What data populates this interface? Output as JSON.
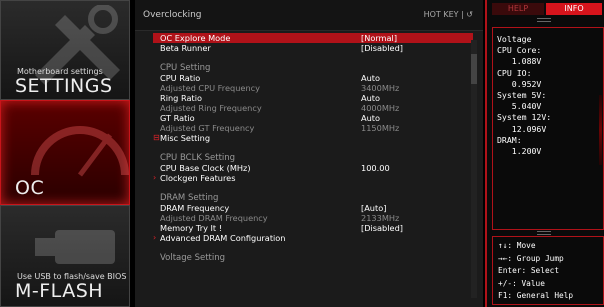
{
  "sidebar": {
    "settings": {
      "subtitle": "Motherboard settings",
      "title": "SETTINGS"
    },
    "oc": {
      "title": "OC"
    },
    "mflash": {
      "subtitle": "Use USB to flash/save BIOS",
      "title": "M-FLASH"
    }
  },
  "header": {
    "title": "Overclocking",
    "hotkey": "HOT KEY  |  ↺"
  },
  "rows": [
    {
      "label": "OC Explore Mode",
      "value": "[Normal]",
      "kind": "item",
      "highlight": true
    },
    {
      "label": "Beta Runner",
      "value": "[Disabled]",
      "kind": "item"
    },
    {
      "label": "",
      "value": "",
      "kind": "gap"
    },
    {
      "label": "CPU  Setting",
      "value": "",
      "kind": "section"
    },
    {
      "label": "CPU Ratio",
      "value": "Auto",
      "kind": "item"
    },
    {
      "label": "Adjusted CPU Frequency",
      "value": "3400MHz",
      "kind": "dim"
    },
    {
      "label": "Ring Ratio",
      "value": "Auto",
      "kind": "item"
    },
    {
      "label": "Adjusted Ring Frequency",
      "value": "4000MHz",
      "kind": "dim"
    },
    {
      "label": "GT Ratio",
      "value": "Auto",
      "kind": "item"
    },
    {
      "label": "Adjusted GT Frequency",
      "value": "1150MHz",
      "kind": "dim"
    },
    {
      "label": "Misc Setting",
      "value": "",
      "kind": "expand",
      "marker": "⊟"
    },
    {
      "label": "",
      "value": "",
      "kind": "gap"
    },
    {
      "label": "CPU  BCLK  Setting",
      "value": "",
      "kind": "section"
    },
    {
      "label": "CPU Base Clock (MHz)",
      "value": "100.00",
      "kind": "item"
    },
    {
      "label": "Clockgen Features",
      "value": "",
      "kind": "expand",
      "marker": "›"
    },
    {
      "label": "",
      "value": "",
      "kind": "gap"
    },
    {
      "label": "DRAM  Setting",
      "value": "",
      "kind": "section"
    },
    {
      "label": "DRAM Frequency",
      "value": "[Auto]",
      "kind": "item"
    },
    {
      "label": "Adjusted DRAM Frequency",
      "value": "2133MHz",
      "kind": "dim"
    },
    {
      "label": "Memory Try It !",
      "value": "[Disabled]",
      "kind": "item"
    },
    {
      "label": "Advanced DRAM Configuration",
      "value": "",
      "kind": "expand",
      "marker": "›"
    },
    {
      "label": "",
      "value": "",
      "kind": "gap"
    },
    {
      "label": "Voltage  Setting",
      "value": "",
      "kind": "section"
    }
  ],
  "panel": {
    "tabs": {
      "help": "HELP",
      "info": "INFO"
    },
    "info_lines": [
      "Voltage",
      "CPU Core:",
      "   1.088V",
      "CPU IO:",
      "   0.952V",
      "System 5V:",
      "   5.040V",
      "System 12V:",
      "   12.096V",
      "DRAM:",
      "   1.200V"
    ],
    "help_lines": [
      "↑↓: Move",
      "→←: Group Jump",
      "Enter: Select",
      "+/-: Value",
      "F1: General Help"
    ]
  },
  "colors": {
    "accent": "#d6141c",
    "highlight_row": "#b01219",
    "dim_text": "#8a8a8a"
  }
}
